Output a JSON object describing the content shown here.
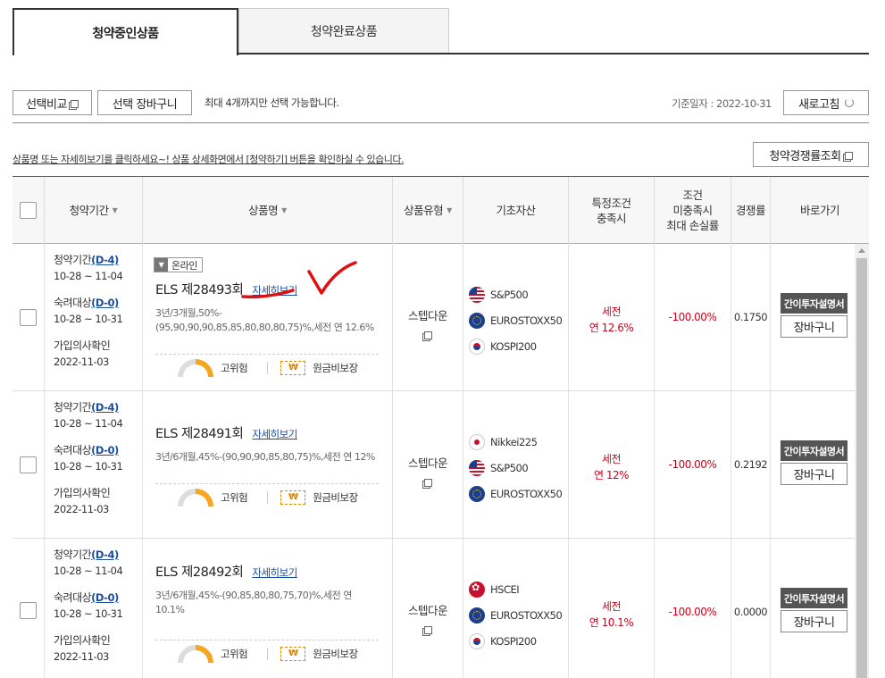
{
  "tabs": [
    {
      "label": "청약중인상품",
      "active": true
    },
    {
      "label": "청약완료상품",
      "active": false
    }
  ],
  "toolbar": {
    "compare_label": "선택비교",
    "cart_label": "선택 장바구니",
    "note": "최대 4개까지만 선택 가능합니다.",
    "base_date": "기준일자 : 2022-10-31",
    "refresh_label": "새로고침"
  },
  "guide_text": "상품명 또는 자세히보기를 클릭하세요~! 상품 상세화면에서 [청약하기] 버튼을 확인하실 수 있습니다.",
  "competition_button": "청약경쟁률조회",
  "headers": {
    "period": "청약기간",
    "name": "상품명",
    "type": "상품유형",
    "assets": "기초자산",
    "cond_line1": "특정조건",
    "cond_line2": "충족시",
    "loss_line1": "조건",
    "loss_line2": "미충족시",
    "loss_line3": "최대 손실률",
    "comp": "경쟁률",
    "go": "바로가기"
  },
  "rows": [
    {
      "period_label": "청약기간",
      "period_dday": "(D-4)",
      "period_dates": "10-28 ~ 11-04",
      "target_label": "숙려대상",
      "target_dday": "(D-0)",
      "target_dates": "10-28 ~ 10-31",
      "confirm_label": "가입의사확인",
      "confirm_date": "2022-11-03",
      "online_badge": "온라인",
      "name": "ELS 제28493회",
      "detail_link": "자세히보기",
      "desc": "3년/3개월,50%-(95,90,90,90,85,85,80,80,80,75)%,세전 연 12.6%",
      "risk": "고위험",
      "won_symbol": "₩",
      "guarantee": "원금비보장",
      "type": "스텝다운",
      "assets": [
        {
          "flag": "us",
          "name": "S&P500"
        },
        {
          "flag": "eu",
          "name": "EUROSTOXX50"
        },
        {
          "flag": "kr",
          "name": "KOSPI200"
        }
      ],
      "cond1": "세전",
      "cond2": "연 12.6%",
      "loss": "-100.00%",
      "comp": "0.1750",
      "go_doc": "간이투자설명서",
      "go_cart": "장바구니"
    },
    {
      "period_label": "청약기간",
      "period_dday": "(D-4)",
      "period_dates": "10-28 ~ 11-04",
      "target_label": "숙려대상",
      "target_dday": "(D-0)",
      "target_dates": "10-28 ~ 10-31",
      "confirm_label": "가입의사확인",
      "confirm_date": "2022-11-03",
      "name": "ELS 제28491회",
      "detail_link": "자세히보기",
      "desc": "3년/6개월,45%-(90,90,90,85,80,75)%,세전 연 12%",
      "risk": "고위험",
      "won_symbol": "₩",
      "guarantee": "원금비보장",
      "type": "스텝다운",
      "assets": [
        {
          "flag": "jp",
          "name": "Nikkei225"
        },
        {
          "flag": "us",
          "name": "S&P500"
        },
        {
          "flag": "eu",
          "name": "EUROSTOXX50"
        }
      ],
      "cond1": "세전",
      "cond2": "연 12%",
      "loss": "-100.00%",
      "comp": "0.2192",
      "go_doc": "간이투자설명서",
      "go_cart": "장바구니"
    },
    {
      "period_label": "청약기간",
      "period_dday": "(D-4)",
      "period_dates": "10-28 ~ 11-04",
      "target_label": "숙려대상",
      "target_dday": "(D-0)",
      "target_dates": "10-28 ~ 10-31",
      "confirm_label": "가입의사확인",
      "confirm_date": "2022-11-03",
      "name": "ELS 제28492회",
      "detail_link": "자세히보기",
      "desc": "3년/6개월,45%-(90,85,80,80,75,70)%,세전 연 10.1%",
      "risk": "고위험",
      "won_symbol": "₩",
      "guarantee": "원금비보장",
      "type": "스텝다운",
      "assets": [
        {
          "flag": "hk",
          "name": "HSCEI"
        },
        {
          "flag": "eu",
          "name": "EUROSTOXX50"
        },
        {
          "flag": "kr",
          "name": "KOSPI200"
        }
      ],
      "cond1": "세전",
      "cond2": "연 10.1%",
      "loss": "-100.00%",
      "comp": "0.0000",
      "go_doc": "간이투자설명서",
      "go_cart": "장바구니"
    }
  ],
  "colors": {
    "accent_red": "#d0021b",
    "link_blue": "#1a4d9c",
    "warning_orange": "#e08a00",
    "annotation_red": "#e01010"
  }
}
